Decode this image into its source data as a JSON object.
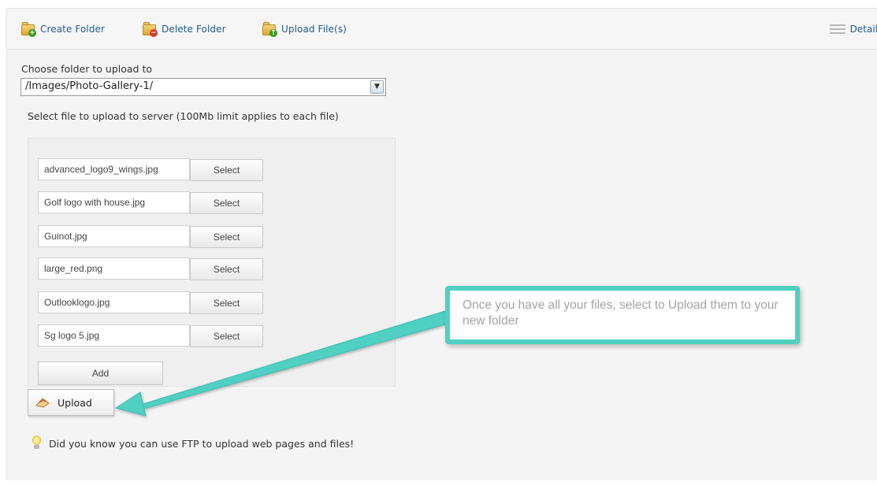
{
  "toolbar": {
    "create_folder": "Create Folder",
    "delete_folder": "Delete Folder",
    "upload_files": "Upload File(s)",
    "detail": "Detail"
  },
  "upload_form": {
    "choose_folder_label": "Choose folder to upload to",
    "selected_folder": "/Images/Photo-Gallery-1/",
    "instructions": "Select file to upload to server (100Mb limit applies to each file)",
    "files": [
      {
        "name": "advanced_logo9_wings.jpg",
        "select_label": "Select"
      },
      {
        "name": "Golf logo with house.jpg",
        "select_label": "Select"
      },
      {
        "name": "Guinot.jpg",
        "select_label": "Select"
      },
      {
        "name": "large_red.png",
        "select_label": "Select"
      },
      {
        "name": "Outlooklogo.jpg",
        "select_label": "Select"
      },
      {
        "name": "Sg logo 5.jpg",
        "select_label": "Select"
      }
    ],
    "add_label": "Add",
    "upload_label": "Upload"
  },
  "tip": "Did you know you can use FTP to upload web pages and files!",
  "callout": "Once you have all your files, select to Upload them to your new folder",
  "colors": {
    "accent_teal": "#4fd0c3",
    "link_blue": "#1f5b8f"
  }
}
